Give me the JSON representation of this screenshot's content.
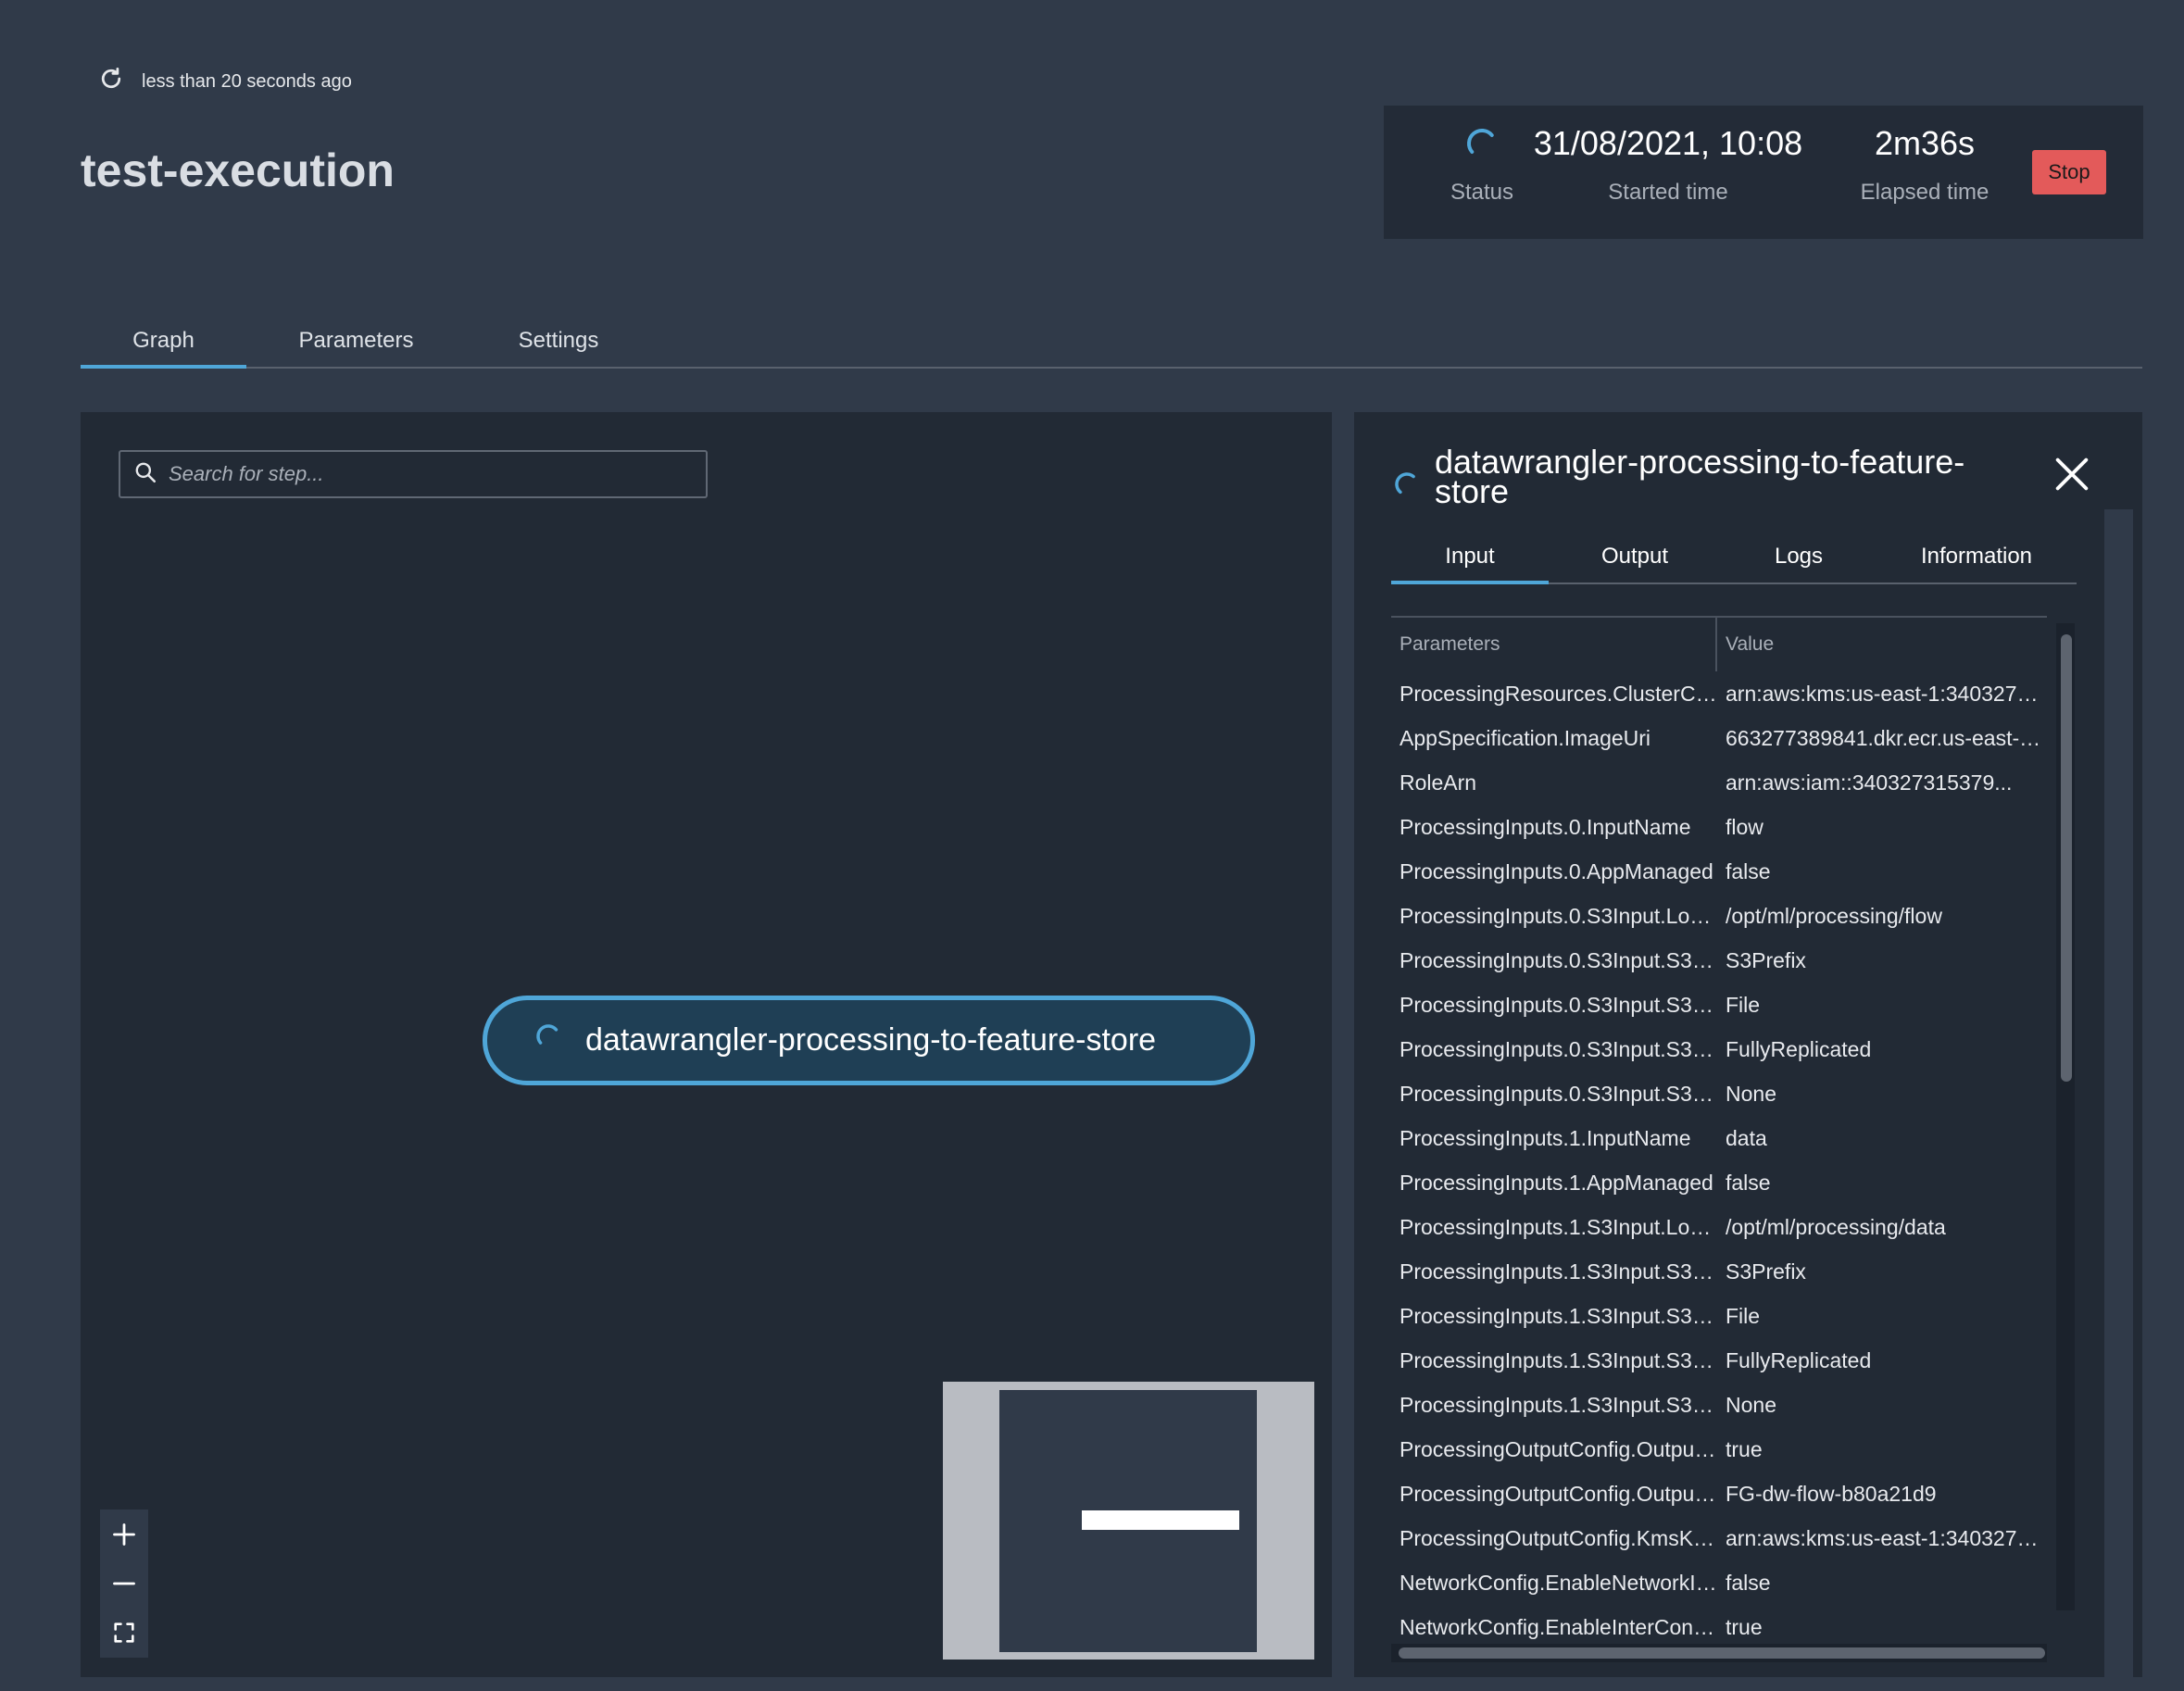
{
  "header": {
    "refresh_text": "less than 20 seconds ago",
    "title": "test-execution",
    "status_label": "Status",
    "started_time": "31/08/2021, 10:08",
    "started_label": "Started time",
    "elapsed_time": "2m36s",
    "elapsed_label": "Elapsed time",
    "stop_label": "Stop"
  },
  "tabs": [
    {
      "label": "Graph",
      "active": true
    },
    {
      "label": "Parameters",
      "active": false
    },
    {
      "label": "Settings",
      "active": false
    }
  ],
  "graph": {
    "search_placeholder": "Search for step...",
    "step_name": "datawrangler-processing-to-feature-store"
  },
  "details": {
    "title": "datawrangler-processing-to-feature-store",
    "tabs": [
      "Input",
      "Output",
      "Logs",
      "Information"
    ],
    "columns": [
      "Parameters",
      "Value"
    ],
    "rows": [
      {
        "param": "ProcessingResources.ClusterConfig.VolumeKmsKeyId",
        "value": "arn:aws:kms:us-east-1:340327315379..."
      },
      {
        "param": "AppSpecification.ImageUri",
        "value": "663277389841.dkr.ecr.us-east-1..."
      },
      {
        "param": "RoleArn",
        "value": "arn:aws:iam::340327315379..."
      },
      {
        "param": "ProcessingInputs.0.InputName",
        "value": "flow"
      },
      {
        "param": "ProcessingInputs.0.AppManaged",
        "value": "false"
      },
      {
        "param": "ProcessingInputs.0.S3Input.LocalPath",
        "value": "/opt/ml/processing/flow"
      },
      {
        "param": "ProcessingInputs.0.S3Input.S3DataType",
        "value": "S3Prefix"
      },
      {
        "param": "ProcessingInputs.0.S3Input.S3InputMode",
        "value": "File"
      },
      {
        "param": "ProcessingInputs.0.S3Input.S3DataDistributionType",
        "value": "FullyReplicated"
      },
      {
        "param": "ProcessingInputs.0.S3Input.S3CompressionType",
        "value": "None"
      },
      {
        "param": "ProcessingInputs.1.InputName",
        "value": "data"
      },
      {
        "param": "ProcessingInputs.1.AppManaged",
        "value": "false"
      },
      {
        "param": "ProcessingInputs.1.S3Input.LocalPath",
        "value": "/opt/ml/processing/data"
      },
      {
        "param": "ProcessingInputs.1.S3Input.S3DataType",
        "value": "S3Prefix"
      },
      {
        "param": "ProcessingInputs.1.S3Input.S3InputMode",
        "value": "File"
      },
      {
        "param": "ProcessingInputs.1.S3Input.S3DataDistributionType",
        "value": "FullyReplicated"
      },
      {
        "param": "ProcessingInputs.1.S3Input.S3CompressionType",
        "value": "None"
      },
      {
        "param": "ProcessingOutputConfig.Outputs.0.AppManaged",
        "value": "true"
      },
      {
        "param": "ProcessingOutputConfig.Outputs.0.FeatureStoreOutput",
        "value": "FG-dw-flow-b80a21d9"
      },
      {
        "param": "ProcessingOutputConfig.KmsKeyId",
        "value": "arn:aws:kms:us-east-1:340327315379..."
      },
      {
        "param": "NetworkConfig.EnableNetworkIsolation",
        "value": "false"
      },
      {
        "param": "NetworkConfig.EnableInterContainerTrafficEncryption",
        "value": "true"
      }
    ]
  },
  "colors": {
    "background": "#303a49",
    "panel": "#222a35",
    "accent": "#4fa6d8",
    "stop": "#e35a5a"
  },
  "icons": [
    "refresh-icon",
    "spinner-icon",
    "search-icon",
    "close-icon",
    "zoom-in-icon",
    "zoom-out-icon",
    "fit-view-icon"
  ]
}
